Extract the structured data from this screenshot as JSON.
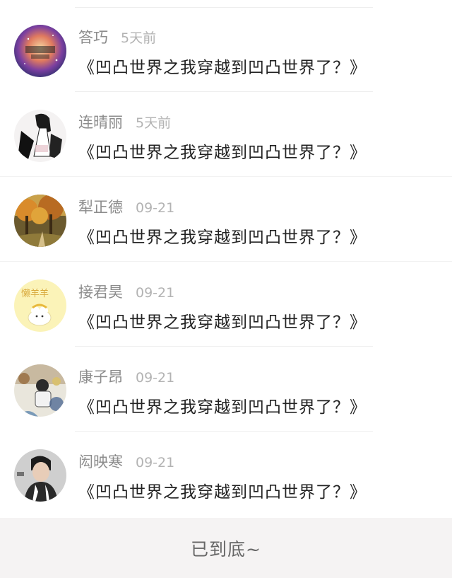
{
  "comments": [
    {
      "name": "答巧",
      "time": "5天前",
      "title": "《凹凸世界之我穿越到凹凸世界了？》",
      "avatar": "galaxy-avatar"
    },
    {
      "name": "连晴丽",
      "time": "5天前",
      "title": "《凹凸世界之我穿越到凹凸世界了？》",
      "avatar": "anime-girl-avatar"
    },
    {
      "name": "犁正德",
      "time": "09-21",
      "title": "《凹凸世界之我穿越到凹凸世界了？》",
      "avatar": "autumn-trees-avatar"
    },
    {
      "name": "接君昊",
      "time": "09-21",
      "title": "《凹凸世界之我穿越到凹凸世界了？》",
      "avatar": "lazy-sheep-avatar"
    },
    {
      "name": "康子昂",
      "time": "09-21",
      "title": "《凹凸世界之我穿越到凹凸世界了？》",
      "avatar": "person-photo-avatar"
    },
    {
      "name": "闳映寒",
      "time": "09-21",
      "title": "《凹凸世界之我穿越到凹凸世界了？》",
      "avatar": "boy-photo-avatar"
    }
  ],
  "avatar_text": {
    "sheep": "懒羊羊"
  },
  "footer": {
    "end_text": "已到底~"
  }
}
